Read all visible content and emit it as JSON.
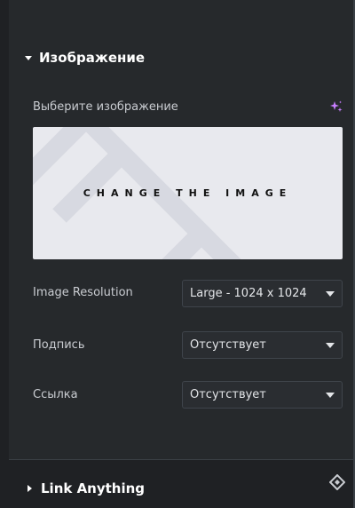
{
  "section": {
    "title": "Изображение",
    "choose_label": "Выберите изображение"
  },
  "preview": {
    "text": "CHANGE THE IMAGE"
  },
  "fields": [
    {
      "label": "Image Resolution",
      "value": "Large - 1024 x 1024"
    },
    {
      "label": "Подпись",
      "value": "Отсутствует"
    },
    {
      "label": "Ссылка",
      "value": "Отсутствует"
    }
  ],
  "bottom_section": {
    "title": "Link Anything"
  },
  "colors": {
    "panel": "#26292c",
    "bar": "#1f2124",
    "accent_magic": "#c77dff"
  }
}
